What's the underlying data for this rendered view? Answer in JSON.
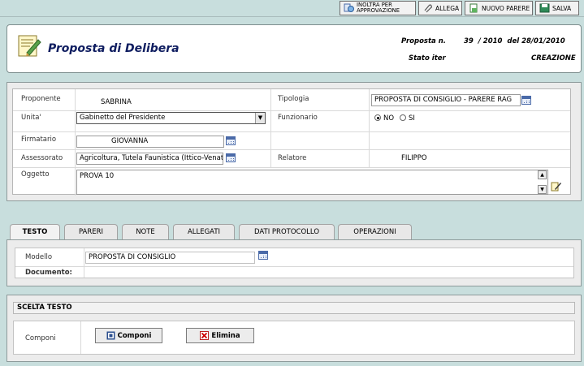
{
  "toolbar": {
    "inoltra_line1": "INOLTRA PER",
    "inoltra_line2": "APPROVAZIONE",
    "allega": "ALLEGA",
    "nuovo_parere": "NUOVO PARERE",
    "salva": "SALVA"
  },
  "header": {
    "title": "Proposta di Delibera",
    "proposta_label": "Proposta n.",
    "proposta_value": "39  / 2010  del 28/01/2010",
    "stato_label": "Stato iter",
    "stato_value": "CREAZIONE"
  },
  "form": {
    "proponente_label": "Proponente",
    "proponente_value": "SABRINA",
    "tipologia_label": "Tipologia",
    "tipologia_value": "PROPOSTA DI CONSIGLIO - PARERE RAG",
    "unita_label": "Unita'",
    "unita_value": "Gabinetto del Presidente",
    "funzionario_label": "Funzionario",
    "radio_no": "NO",
    "radio_si": "SI",
    "firmatario_label": "Firmatario",
    "firmatario_value": "GIOVANNA",
    "assessorato_label": "Assessorato",
    "assessorato_value": "Agricoltura, Tutela Faunistica (Ittico-Venat",
    "relatore_label": "Relatore",
    "relatore_value": "FILIPPO",
    "oggetto_label": "Oggetto",
    "oggetto_value": "PROVA 10"
  },
  "tabs": [
    "TESTO",
    "PARERI",
    "NOTE",
    "ALLEGATI",
    "DATI PROTOCOLLO",
    "OPERAZIONI"
  ],
  "testo": {
    "modello_label": "Modello",
    "modello_value": "PROPOSTA DI CONSIGLIO",
    "documento_label": "Documento:"
  },
  "scelta": {
    "title": "SCELTA TESTO",
    "componi_label": "Componi",
    "componi_button": "Componi",
    "elimina_button": "Elimina"
  }
}
